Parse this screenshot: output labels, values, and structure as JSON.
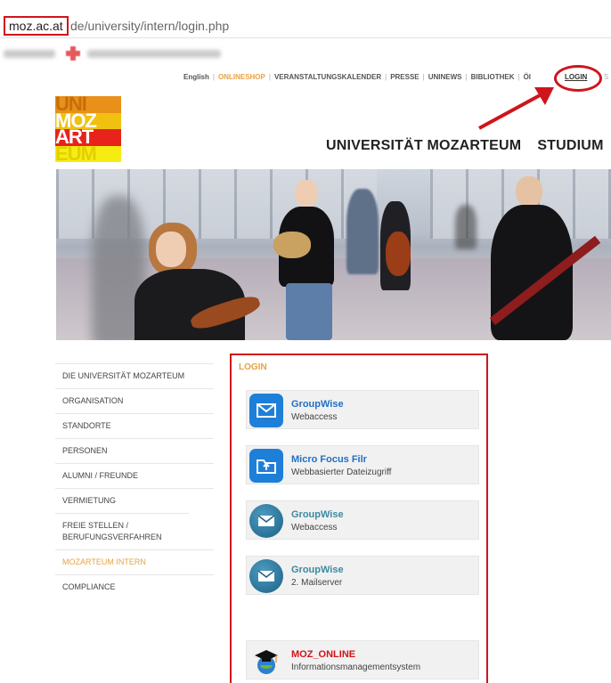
{
  "browser": {
    "url_host": "moz.ac.at",
    "url_path": "de/university/intern/login.php"
  },
  "topnav": {
    "items": [
      "English",
      "ONLINESHOP",
      "VERANSTALTUNGSKALENDER",
      "PRESSE",
      "UNINEWS",
      "BIBLIOTHEK",
      "ÖI"
    ],
    "login": "LOGIN",
    "tail": "S"
  },
  "logo": {
    "rows": [
      "UNI",
      "MOZ",
      "ART",
      "EUM"
    ]
  },
  "header": {
    "title": "UNIVERSITÄT MOZARTEUM",
    "section": "STUDIUM"
  },
  "sidebar": {
    "items": [
      "DIE UNIVERSITÄT MOZARTEUM",
      "ORGANISATION",
      "STANDORTE",
      "PERSONEN",
      "ALUMNI / FREUNDE",
      "VERMIETUNG",
      "FREIE STELLEN / BERUFUNGSVERFAHREN",
      "MOZARTEUM INTERN",
      "COMPLIANCE"
    ],
    "active_index": 7
  },
  "login": {
    "title": "LOGIN",
    "cards": [
      {
        "title": "GroupWise",
        "subtitle": "Webaccess",
        "icon": "mail-envelope-icon",
        "title_color": "#1f6fc4"
      },
      {
        "title": "Micro Focus Filr",
        "subtitle": "Webbasierter Dateizugriff",
        "icon": "folder-upload-icon",
        "title_color": "#1f6fc4"
      },
      {
        "title": "GroupWise",
        "subtitle": "Webaccess",
        "icon": "envelope-round-icon",
        "title_color": "#3a8aa0"
      },
      {
        "title": "GroupWise",
        "subtitle": "2. Mailserver",
        "icon": "envelope-round-icon",
        "title_color": "#3a8aa0"
      },
      {
        "title": "MOZ_ONLINE",
        "subtitle": "Informationsmanagementsystem",
        "icon": "graduation-cap-globe-icon",
        "title_color": "#d0141b"
      }
    ]
  },
  "colors": {
    "accent_orange": "#e8a244",
    "highlight_red": "#d0141b"
  }
}
